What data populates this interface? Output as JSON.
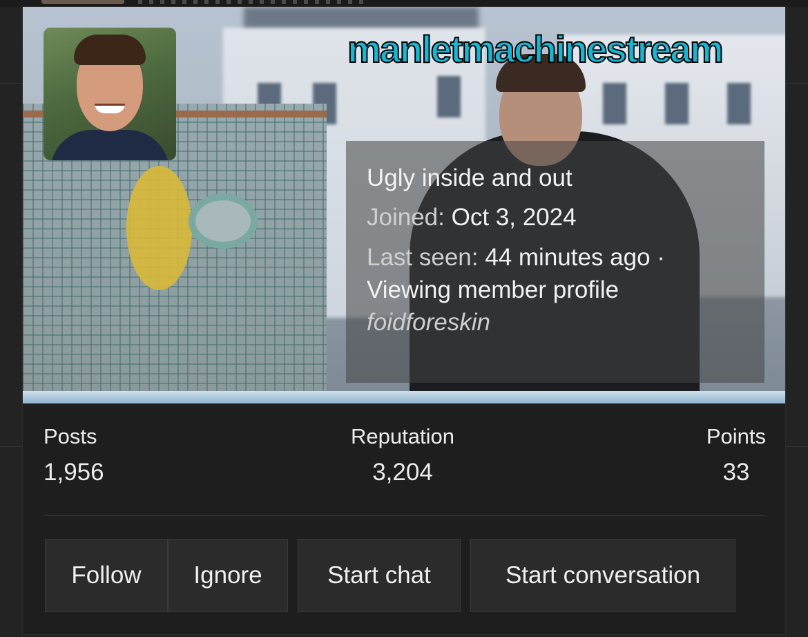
{
  "username": "manletmachinestream",
  "profile": {
    "custom_title": "Ugly inside and out",
    "joined_label": "Joined:",
    "joined_value": "Oct 3, 2024",
    "last_seen_label": "Last seen:",
    "last_seen_value": "44 minutes ago · Viewing member profile",
    "status": "foidforeskin"
  },
  "stats": {
    "posts_label": "Posts",
    "posts_value": "1,956",
    "reputation_label": "Reputation",
    "reputation_value": "3,204",
    "points_label": "Points",
    "points_value": "33"
  },
  "actions": {
    "follow": "Follow",
    "ignore": "Ignore",
    "start_chat": "Start chat",
    "start_conversation": "Start conversation"
  },
  "colors": {
    "username": "#17b6d2",
    "card_bg": "#1e1e1e",
    "button_bg": "#2b2b2b"
  }
}
